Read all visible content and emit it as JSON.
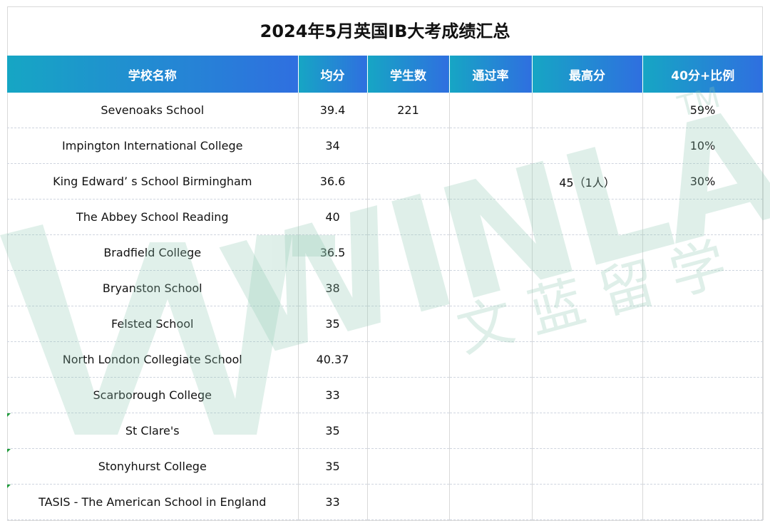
{
  "title": "2024年5月英国IB大考成绩汇总",
  "watermark": {
    "brand": "WINLAND",
    "trademark": "TM",
    "chinese": "文 蓝 留 学",
    "color": "#8fc9b3"
  },
  "colors": {
    "header_gradient_start": "#16a6c4",
    "header_gradient_end": "#2f6fe0",
    "comment_flag": "#1f9a3a"
  },
  "columns": [
    "学校名称",
    "均分",
    "学生数",
    "通过率",
    "最高分",
    "40分+比例"
  ],
  "rows": [
    {
      "school": "Sevenoaks School",
      "avg": "39.4",
      "students": "221",
      "pass_rate": "",
      "max": "",
      "ratio40": "59%",
      "flag": false
    },
    {
      "school": "Impington International College",
      "avg": "34",
      "students": "",
      "pass_rate": "",
      "max": "",
      "ratio40": "10%",
      "flag": false
    },
    {
      "school": "King Edward’ s School Birmingham",
      "avg": "36.6",
      "students": "",
      "pass_rate": "",
      "max": "45（1人）",
      "ratio40": "30%",
      "flag": false
    },
    {
      "school": "The Abbey School Reading",
      "avg": "40",
      "students": "",
      "pass_rate": "",
      "max": "",
      "ratio40": "",
      "flag": false
    },
    {
      "school": "Bradfield College",
      "avg": "36.5",
      "students": "",
      "pass_rate": "",
      "max": "",
      "ratio40": "",
      "flag": false
    },
    {
      "school": "Bryanston School",
      "avg": "38",
      "students": "",
      "pass_rate": "",
      "max": "",
      "ratio40": "",
      "flag": false
    },
    {
      "school": "Felsted School",
      "avg": "35",
      "students": "",
      "pass_rate": "",
      "max": "",
      "ratio40": "",
      "flag": false
    },
    {
      "school": "North London Collegiate School",
      "avg": "40.37",
      "students": "",
      "pass_rate": "",
      "max": "",
      "ratio40": "",
      "flag": false
    },
    {
      "school": "Scarborough College",
      "avg": "33",
      "students": "",
      "pass_rate": "",
      "max": "",
      "ratio40": "",
      "flag": false
    },
    {
      "school": "St Clare's",
      "avg": "35",
      "students": "",
      "pass_rate": "",
      "max": "",
      "ratio40": "",
      "flag": true
    },
    {
      "school": "Stonyhurst College",
      "avg": "35",
      "students": "",
      "pass_rate": "",
      "max": "",
      "ratio40": "",
      "flag": true
    },
    {
      "school": "TASIS - The American School in England",
      "avg": "33",
      "students": "",
      "pass_rate": "",
      "max": "",
      "ratio40": "",
      "flag": true
    }
  ]
}
